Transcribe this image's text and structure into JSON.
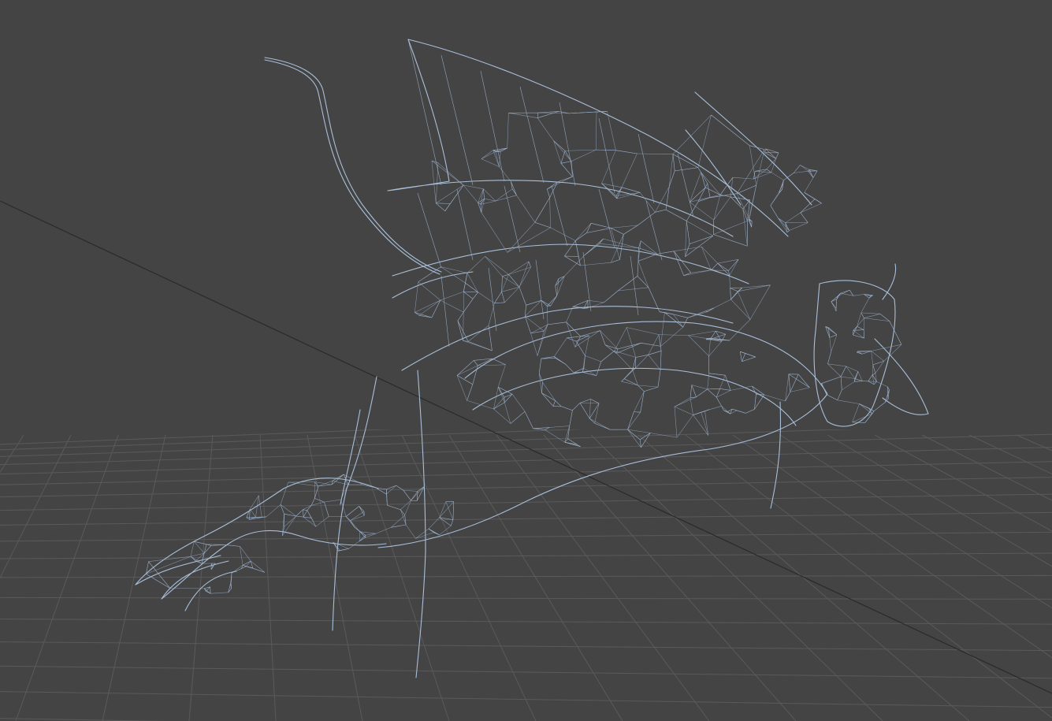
{
  "viewport": {
    "view": "perspective",
    "shading": "wireframe",
    "grid": true,
    "background_color": "#444444",
    "grid_color": "#5a5a5a",
    "axis_color": "#2a2a2a",
    "wireframe_color": "#a9bfd9"
  },
  "model": {
    "icon": "dragon-wireframe-model"
  }
}
